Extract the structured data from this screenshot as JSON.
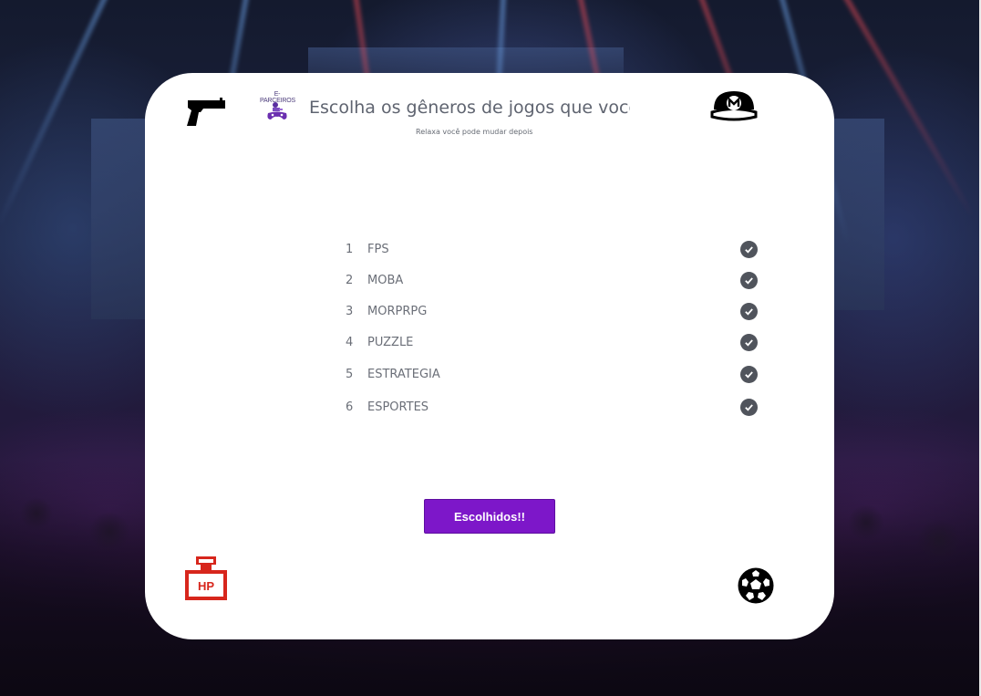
{
  "page": {
    "title": "Escolha os gêneros de jogos que você gosta",
    "subtitle": "Relaxa você pode mudar depois"
  },
  "logo": {
    "text": "E-PARCEIROS"
  },
  "genres": [
    {
      "number": "1",
      "label": "FPS",
      "selected": true
    },
    {
      "number": "2",
      "label": "MOBA",
      "selected": true
    },
    {
      "number": "3",
      "label": "MORPRPG",
      "selected": true
    },
    {
      "number": "4",
      "label": "PUZZLE",
      "selected": true
    },
    {
      "number": "5",
      "label": "ESTRATEGIA",
      "selected": true
    },
    {
      "number": "6",
      "label": "ESPORTES",
      "selected": true
    }
  ],
  "button": {
    "label": "Escolhidos!!"
  },
  "icons": {
    "top_left": "gun-icon",
    "top_right": "mario-cap-icon",
    "bottom_left": "hp-potion-icon",
    "bottom_right": "soccer-ball-icon",
    "check": "check-circle-icon"
  },
  "colors": {
    "button": "#7d17c9",
    "check": "#50545c",
    "potion": "#d7261c",
    "card": "#ffffff"
  }
}
